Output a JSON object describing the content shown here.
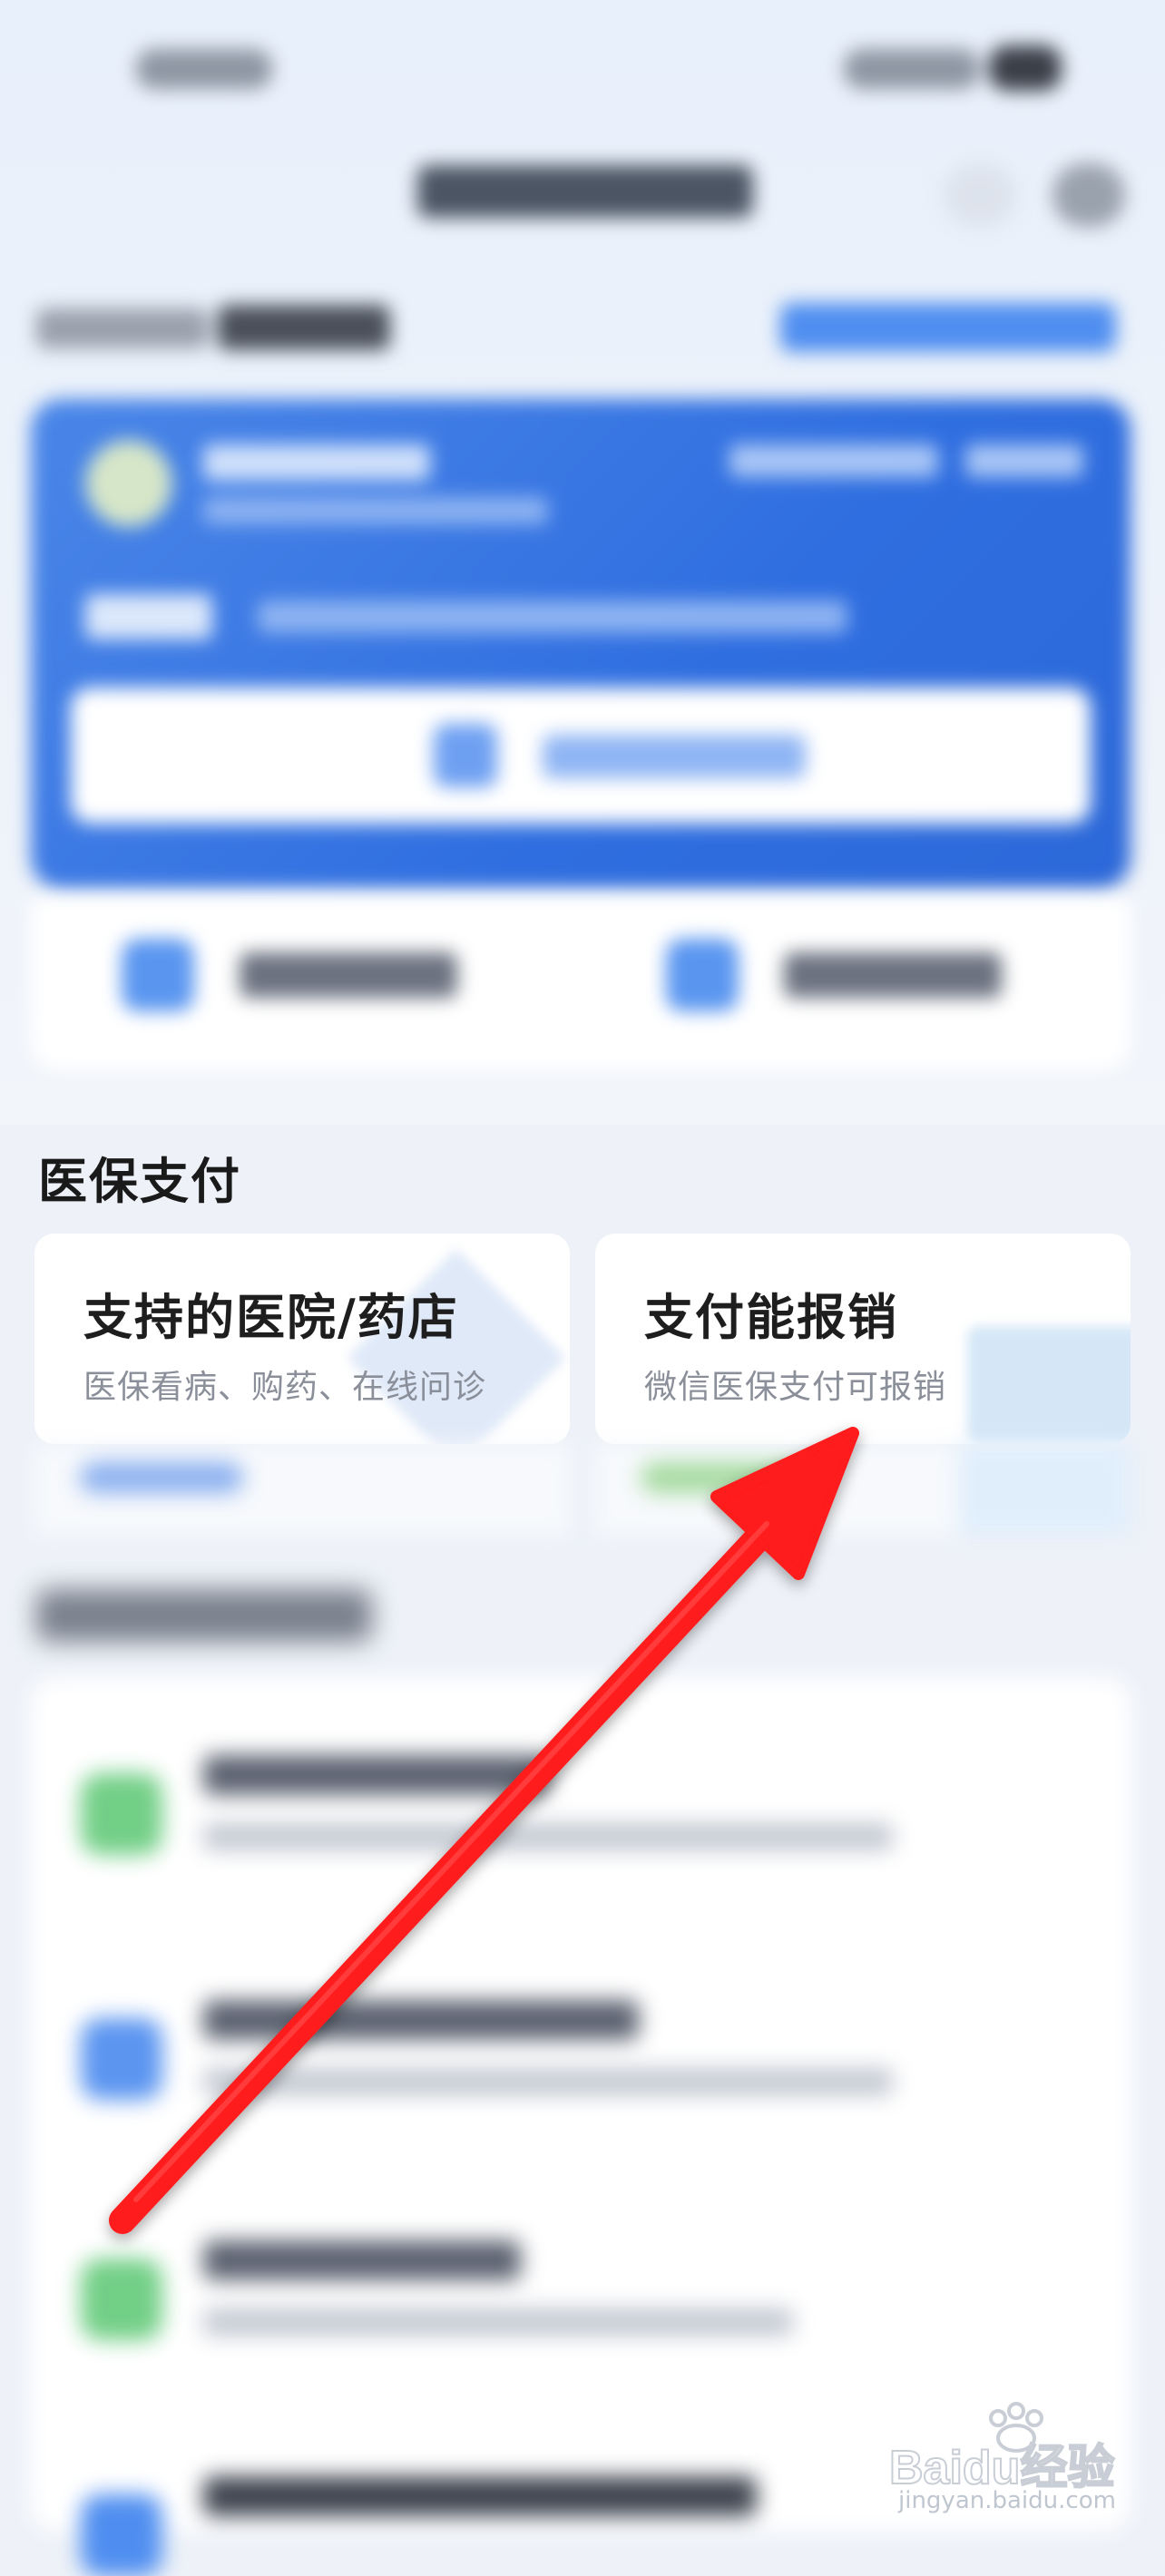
{
  "section": {
    "title": "医保支付"
  },
  "cards": [
    {
      "title": "支持的医院/药店",
      "subtitle": "医保看病、购药、在线问诊"
    },
    {
      "title": "支付能报销",
      "subtitle": "微信医保支付可报销"
    }
  ],
  "watermark": {
    "logo_text": "Baidu经验",
    "url": "jingyan.baidu.com"
  },
  "colors": {
    "accent_blue": "#2f6ee0",
    "annotation_red": "#ff1a1a",
    "background": "#eef2f8"
  },
  "icons": [
    "back-icon",
    "more-icon",
    "medical-card-icon",
    "annotation-arrow-icon"
  ]
}
